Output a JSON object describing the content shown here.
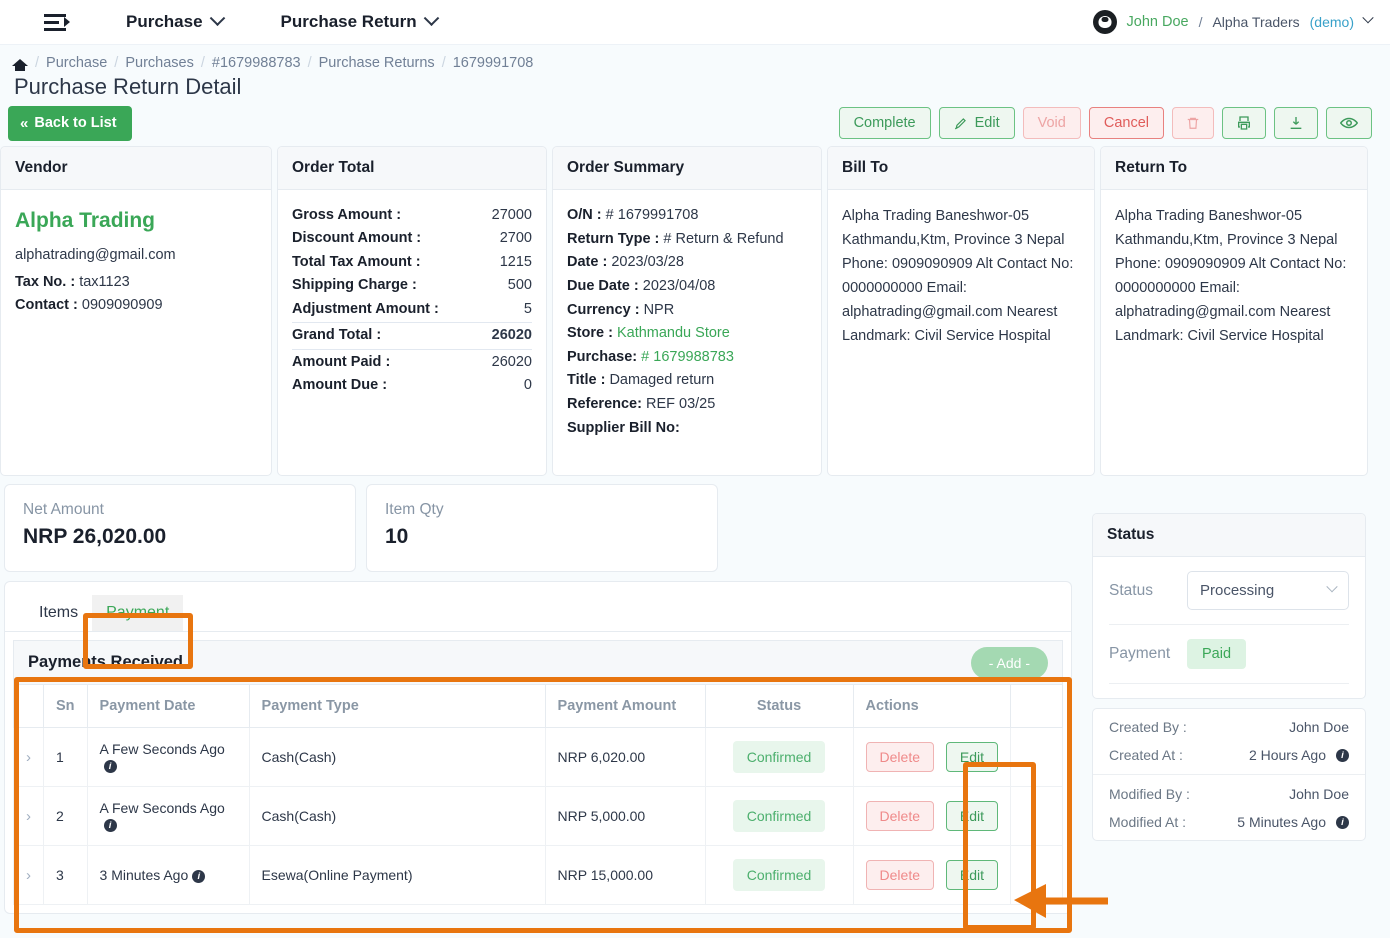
{
  "topnav": {
    "menu_icon": "sidebar-collapse-icon",
    "items": [
      {
        "label": "Purchase"
      },
      {
        "label": "Purchase Return"
      }
    ],
    "user": {
      "avatar_icon": "github-avatar-icon",
      "name": "John Doe",
      "separator": "/",
      "company": "Alpha Traders",
      "demo": "(demo)"
    }
  },
  "breadcrumb": {
    "home_icon": "home-icon",
    "items": [
      "Purchase",
      "Purchases",
      "#1679988783",
      "Purchase Returns",
      "1679991708"
    ],
    "separator": "/"
  },
  "page_title": "Purchase Return Detail",
  "actions": {
    "back": "Back to List",
    "complete": "Complete",
    "edit": "Edit",
    "void": "Void",
    "cancel": "Cancel",
    "delete_icon": "trash-icon",
    "print_icon": "printer-icon",
    "download_icon": "download-icon",
    "preview_icon": "eye-icon"
  },
  "vendor": {
    "title": "Vendor",
    "name": "Alpha Trading",
    "email": "alphatrading@gmail.com",
    "tax_label": "Tax No. :",
    "tax_value": "tax1123",
    "contact_label": "Contact :",
    "contact_value": "0909090909"
  },
  "order_total": {
    "title": "Order Total",
    "rows": [
      {
        "label": "Gross Amount :",
        "value": "27000"
      },
      {
        "label": "Discount Amount :",
        "value": "2700"
      },
      {
        "label": "Total Tax Amount :",
        "value": "1215"
      },
      {
        "label": "Shipping Charge :",
        "value": "500"
      },
      {
        "label": "Adjustment Amount :",
        "value": "5"
      },
      {
        "label": "Grand Total :",
        "value": "26020"
      },
      {
        "label": "Amount Paid :",
        "value": "26020"
      },
      {
        "label": "Amount Due :",
        "value": "0"
      }
    ]
  },
  "order_summary": {
    "title": "Order Summary",
    "on_label": "O/N :",
    "on_value": "# 1679991708",
    "return_type_label": "Return Type :",
    "return_type_value": "# Return & Refund",
    "date_label": "Date :",
    "date_value": "2023/03/28",
    "due_date_label": "Due Date :",
    "due_date_value": "2023/04/08",
    "currency_label": "Currency :",
    "currency_value": "NPR",
    "store_label": "Store :",
    "store_value": "Kathmandu Store",
    "purchase_label": "Purchase:",
    "purchase_value": "# 1679988783",
    "title_label": "Title :",
    "title_value": "Damaged return",
    "reference_label": "Reference:",
    "reference_value": "REF 03/25",
    "supplier_bill_label": "Supplier Bill No:",
    "supplier_bill_value": ""
  },
  "bill_to": {
    "title": "Bill To",
    "address": "Alpha Trading Baneshwor-05 Kathmandu,Ktm, Province 3 Nepal Phone: 0909090909 Alt Contact No: 0000000000 Email: alphatrading@gmail.com Nearest Landmark: Civil Service Hospital"
  },
  "return_to": {
    "title": "Return To",
    "address": "Alpha Trading Baneshwor-05 Kathmandu,Ktm, Province 3 Nepal Phone: 0909090909 Alt Contact No: 0000000000 Email: alphatrading@gmail.com Nearest Landmark: Civil Service Hospital"
  },
  "stats": [
    {
      "label": "Net Amount",
      "value": "NRP 26,020.00"
    },
    {
      "label": "Item Qty",
      "value": "10"
    }
  ],
  "tabs": [
    {
      "label": "Items",
      "active": false
    },
    {
      "label": "Payment",
      "active": true
    }
  ],
  "payments": {
    "title": "Payments Received",
    "add_label": "- Add -",
    "columns": [
      "",
      "Sn",
      "Payment Date",
      "Payment Type",
      "Payment Amount",
      "Status",
      "Actions",
      ""
    ],
    "rows": [
      {
        "sn": "1",
        "date": "A Few Seconds Ago",
        "type": "Cash(Cash)",
        "amount": "NRP 6,020.00",
        "status": "Confirmed",
        "delete": "Delete",
        "edit": "Edit"
      },
      {
        "sn": "2",
        "date": "A Few Seconds Ago",
        "type": "Cash(Cash)",
        "amount": "NRP 5,000.00",
        "status": "Confirmed",
        "delete": "Delete",
        "edit": "Edit"
      },
      {
        "sn": "3",
        "date": "3 Minutes Ago",
        "type": "Esewa(Online Payment)",
        "amount": "NRP 15,000.00",
        "status": "Confirmed",
        "delete": "Delete",
        "edit": "Edit"
      }
    ]
  },
  "status_panel": {
    "title": "Status",
    "status_label": "Status",
    "status_value": "Processing",
    "payment_label": "Payment",
    "payment_value": "Paid",
    "meta": [
      {
        "label": "Created By :",
        "value": "John Doe",
        "info": false
      },
      {
        "label": "Created At :",
        "value": "2 Hours Ago",
        "info": true
      },
      {
        "label": "Modified By :",
        "value": "John Doe",
        "info": false
      },
      {
        "label": "Modified At :",
        "value": "5 Minutes Ago",
        "info": true
      }
    ]
  },
  "colors": {
    "brand_green": "#3aa757",
    "annotation_orange": "#e8750f",
    "danger_red": "#e05c5a",
    "muted": "#8795a5"
  }
}
